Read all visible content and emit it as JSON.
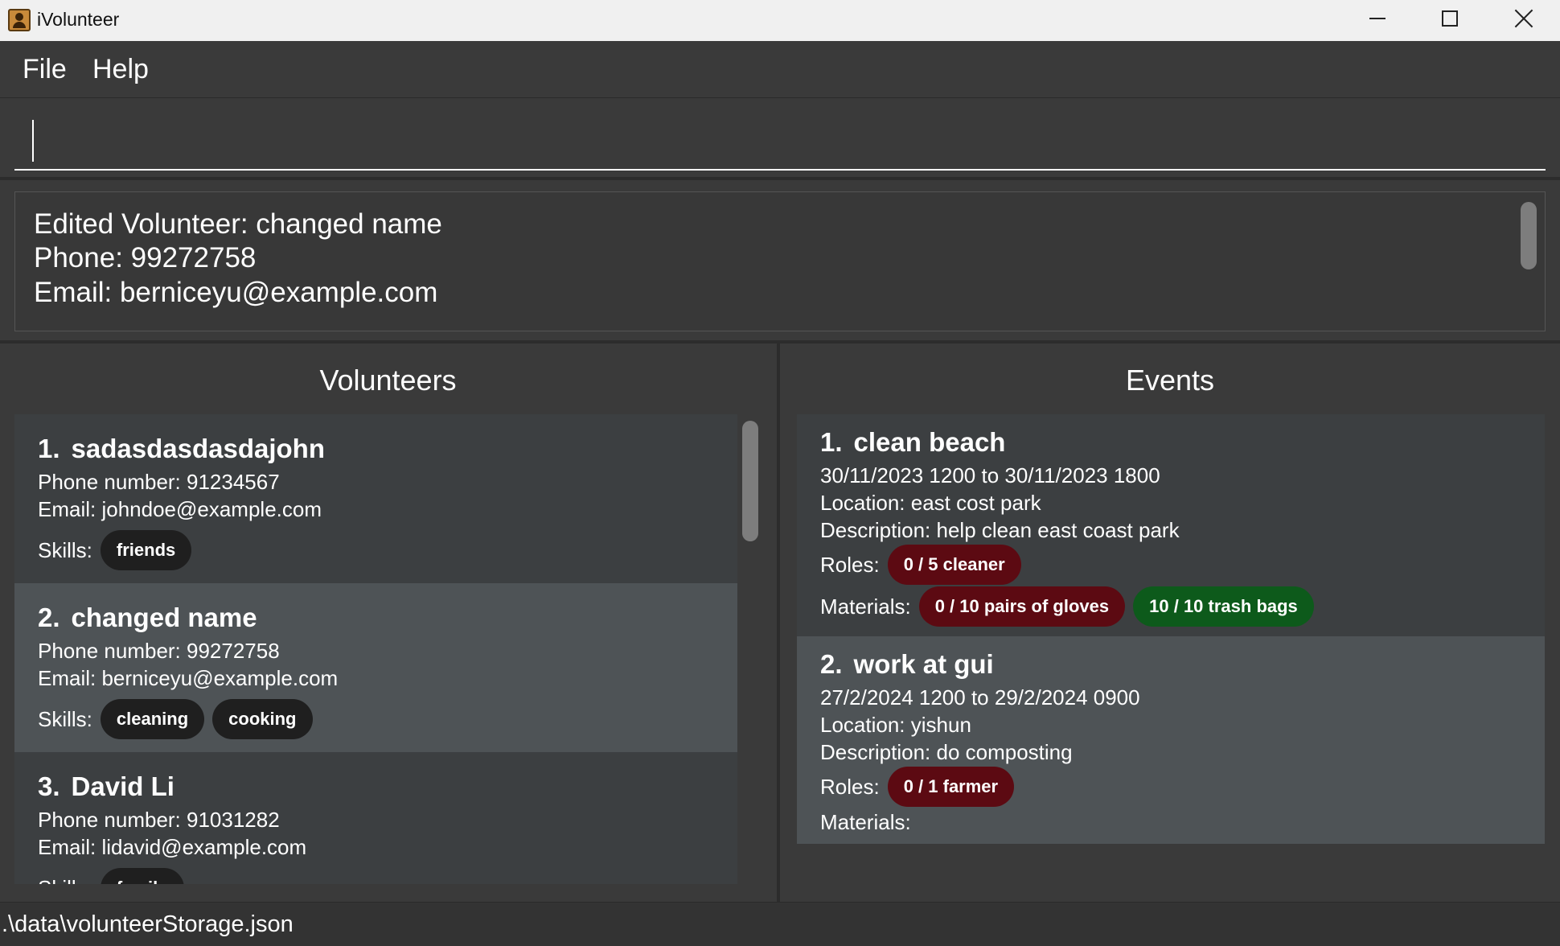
{
  "window": {
    "title": "iVolunteer"
  },
  "menu": {
    "file": "File",
    "help": "Help"
  },
  "command": {
    "value": ""
  },
  "result": {
    "lines": [
      "Edited Volunteer: changed name",
      "Phone: 99272758",
      "Email: berniceyu@example.com"
    ]
  },
  "volunteers": {
    "title": "Volunteers",
    "skills_label": "Skills:",
    "items": [
      {
        "index": "1.",
        "name": "sadasdasdasdajohn",
        "phone": "Phone number: 91234567",
        "email": "Email: johndoe@example.com",
        "skills": [
          "friends"
        ]
      },
      {
        "index": "2.",
        "name": "changed name",
        "phone": "Phone number: 99272758",
        "email": "Email: berniceyu@example.com",
        "skills": [
          "cleaning",
          "cooking"
        ]
      },
      {
        "index": "3.",
        "name": "David Li",
        "phone": "Phone number: 91031282",
        "email": "Email: lidavid@example.com",
        "skills": [
          "family"
        ]
      }
    ]
  },
  "events": {
    "title": "Events",
    "roles_label": "Roles:",
    "materials_label": "Materials:",
    "items": [
      {
        "index": "1.",
        "name": "clean beach",
        "datetime": "30/11/2023 1200 to 30/11/2023 1800",
        "location": "Location: east cost park",
        "description": "Description: help clean east coast park",
        "roles": [
          {
            "text": "0 / 5 cleaner",
            "status": "incomplete"
          }
        ],
        "materials": [
          {
            "text": "0 / 10 pairs of gloves",
            "status": "incomplete"
          },
          {
            "text": "10 / 10 trash bags",
            "status": "complete"
          }
        ]
      },
      {
        "index": "2.",
        "name": "work at gui",
        "datetime": "27/2/2024 1200 to 29/2/2024 0900",
        "location": "Location: yishun",
        "description": "Description: do composting",
        "roles": [
          {
            "text": "0 / 1 farmer",
            "status": "incomplete"
          }
        ],
        "materials": []
      }
    ]
  },
  "status": {
    "path": ".\\data\\volunteerStorage.json"
  },
  "colors": {
    "incomplete": "#5c0a12",
    "complete": "#0d5a1b",
    "skill_tag": "#1f1f1f"
  }
}
